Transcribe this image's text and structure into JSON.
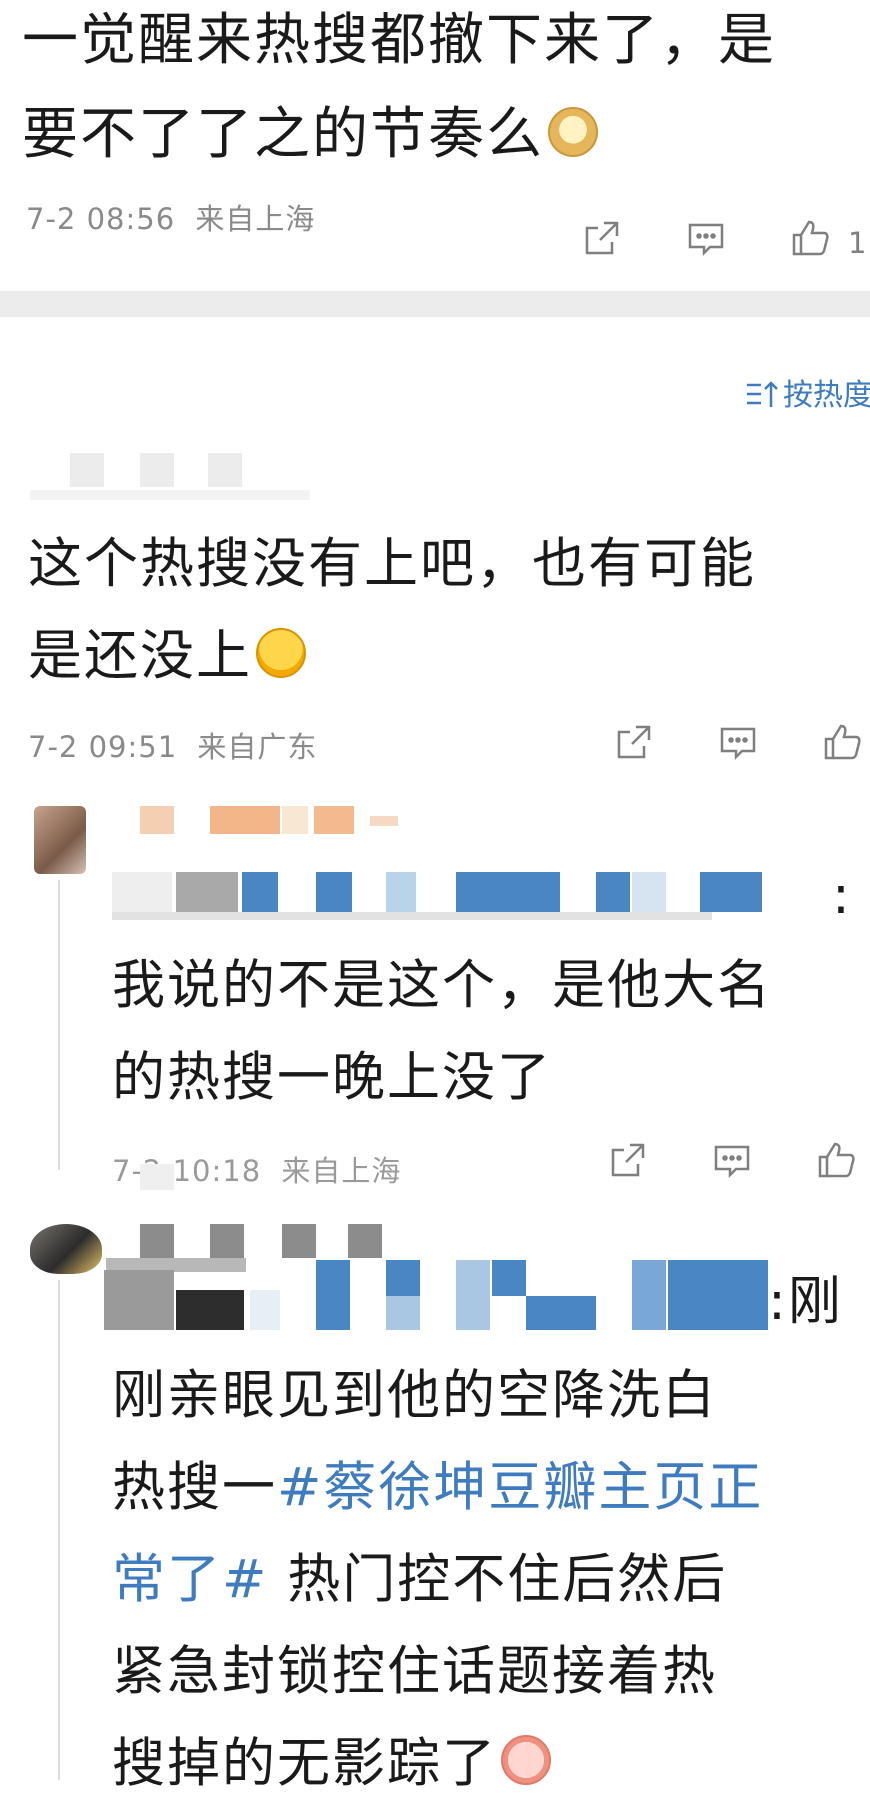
{
  "post": {
    "line1": "一觉醒来热搜都撤下来了，是",
    "line2": "要不了了之的节奏么",
    "emoji": "doge-emoji",
    "time": "7-2 08:56",
    "location": "来自上海",
    "like_count": "1"
  },
  "sort": {
    "label": "按热度"
  },
  "comment1": {
    "line1": "这个热搜没有上吧，也有可能",
    "line2": "是还没上",
    "emoji": "laugh-emoji",
    "time": "7-2 09:51",
    "location": "来自广东"
  },
  "reply1": {
    "line1_end": ":",
    "line2": "我说的不是这个，是他大名",
    "line3": "的热搜一晚上没了",
    "time": "7-2 10:18",
    "location": "来自上海"
  },
  "reply2": {
    "line1_end": ":刚",
    "line2": "刚亲眼见到他的空降洗白",
    "line3_prefix": "热搜一",
    "topic_part1": "#蔡徐坤豆瓣主页正",
    "topic_part2": "常了#",
    "line4_suffix": " 热门控不住后然后",
    "line5": "紧急封锁控住话题接着热",
    "line6": "搜掉的无影踪了",
    "emoji": "pig-emoji"
  },
  "icons": {
    "share": "share-icon",
    "comment": "comment-icon",
    "like": "like-icon",
    "sort": "sort-icon"
  },
  "colors": {
    "accent": "#3e7bbf",
    "meta": "#8a8a8a",
    "divider": "#ececec"
  }
}
